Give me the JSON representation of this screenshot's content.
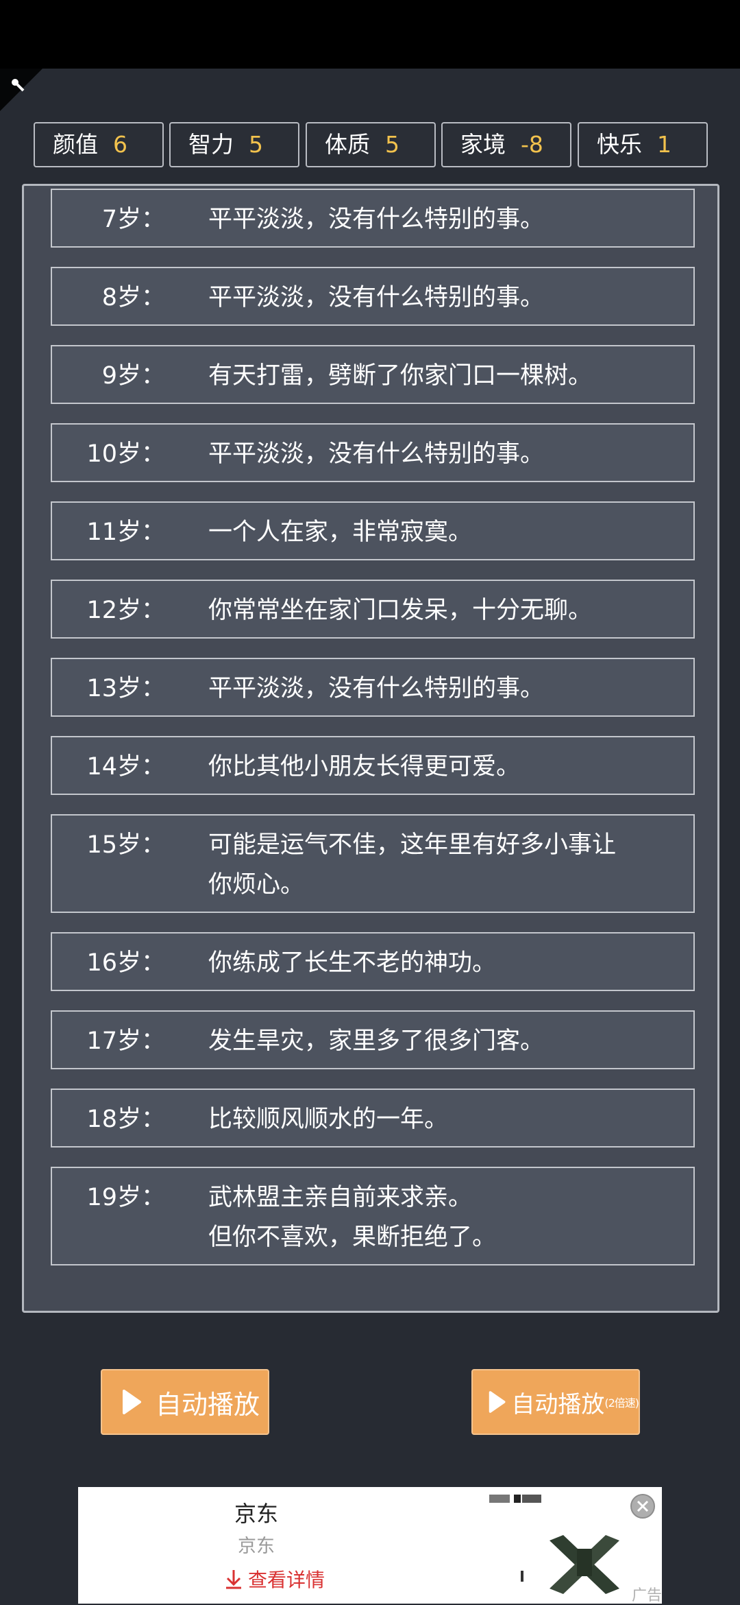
{
  "stats": [
    {
      "label": "颜值",
      "value": "6"
    },
    {
      "label": "智力",
      "value": "5"
    },
    {
      "label": "体质",
      "value": "5"
    },
    {
      "label": "家境",
      "value": "-8"
    },
    {
      "label": "快乐",
      "value": "1"
    }
  ],
  "events": [
    {
      "age": "7岁：",
      "lines": [
        "平平淡淡，没有什么特别的事。"
      ]
    },
    {
      "age": "8岁：",
      "lines": [
        "平平淡淡，没有什么特别的事。"
      ]
    },
    {
      "age": "9岁：",
      "lines": [
        "有天打雷，劈断了你家门口一棵树。"
      ]
    },
    {
      "age": "10岁：",
      "lines": [
        "平平淡淡，没有什么特别的事。"
      ]
    },
    {
      "age": "11岁：",
      "lines": [
        "一个人在家，非常寂寞。"
      ]
    },
    {
      "age": "12岁：",
      "lines": [
        "你常常坐在家门口发呆，十分无聊。"
      ]
    },
    {
      "age": "13岁：",
      "lines": [
        "平平淡淡，没有什么特别的事。"
      ]
    },
    {
      "age": "14岁：",
      "lines": [
        "你比其他小朋友长得更可爱。"
      ]
    },
    {
      "age": "15岁：",
      "lines": [
        "可能是运气不佳，这年里有好多小事让",
        "你烦心。"
      ]
    },
    {
      "age": "16岁：",
      "lines": [
        "你练成了长生不老的神功。"
      ]
    },
    {
      "age": "17岁：",
      "lines": [
        "发生旱灾，家里多了很多门客。"
      ]
    },
    {
      "age": "18岁：",
      "lines": [
        "比较顺风顺水的一年。"
      ]
    },
    {
      "age": "19岁：",
      "lines": [
        "武林盟主亲自前来求亲。",
        "但你不喜欢，果断拒绝了。"
      ]
    }
  ],
  "buttons": {
    "auto_play": "自动播放",
    "auto_play_2x": "自动播放",
    "auto_play_2x_suffix": "(2倍速)",
    "icon": "play-icon",
    "color": "#efa65a"
  },
  "ad": {
    "title": "京东",
    "subtitle": "京东",
    "link": "查看详情",
    "tag": "广告"
  },
  "colors": {
    "background": "#272b33",
    "panel": "#454a55",
    "row": "#4d535f",
    "stat_value": "#f2c24d",
    "ad_link": "#d93232"
  }
}
